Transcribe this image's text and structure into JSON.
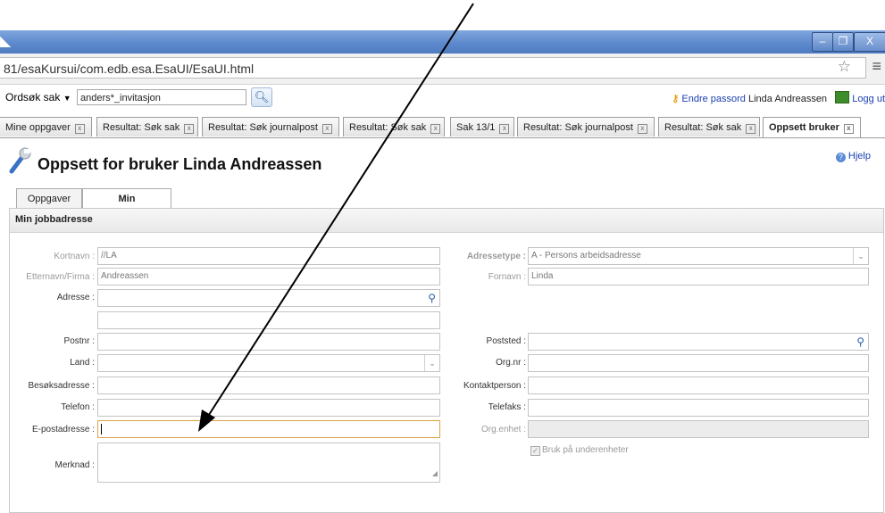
{
  "browser": {
    "url": "81/esaKursui/com.edb.esa.EsaUI/EsaUI.html",
    "window_buttons": [
      "–",
      "❐",
      "X"
    ]
  },
  "toolbar": {
    "search_type": "Ordsøk sak",
    "search_value": "anders*_invitasjon",
    "change_password": "Endre passord",
    "user_name": "Linda Andreassen",
    "logout": "Logg ut"
  },
  "tabs": [
    {
      "label": "Mine oppgaver"
    },
    {
      "label": "Resultat: Søk sak"
    },
    {
      "label": "Resultat: Søk journalpost"
    },
    {
      "label": "Resultat: Søk sak"
    },
    {
      "label": "Sak 13/1"
    },
    {
      "label": "Resultat: Søk journalpost"
    },
    {
      "label": "Resultat: Søk sak"
    },
    {
      "label": "Oppsett bruker",
      "active": true
    }
  ],
  "page": {
    "title": "Oppsett for bruker Linda Andreassen",
    "help": "Hjelp",
    "subtabs": [
      "Oppgaver",
      "Min jobbadresse"
    ],
    "panel_title": "Min jobbadresse"
  },
  "form": {
    "kortnavn": {
      "label": "Kortnavn :",
      "value": "//LA"
    },
    "etternavn": {
      "label": "Etternavn/Firma :",
      "value": "Andreassen"
    },
    "adresse": {
      "label": "Adresse :",
      "value": ""
    },
    "adresse2": {
      "value": ""
    },
    "postnr": {
      "label": "Postnr :",
      "value": ""
    },
    "land": {
      "label": "Land :",
      "value": ""
    },
    "besoksadresse": {
      "label": "Besøksadresse :",
      "value": ""
    },
    "telefon": {
      "label": "Telefon :",
      "value": ""
    },
    "epost": {
      "label": "E-postadresse :",
      "value": ""
    },
    "merknad": {
      "label": "Merknad :",
      "value": ""
    },
    "adressetype": {
      "label": "Adressetype :",
      "value": "A - Persons arbeidsadresse"
    },
    "fornavn": {
      "label": "Fornavn :",
      "value": "Linda"
    },
    "poststed": {
      "label": "Poststed :",
      "value": ""
    },
    "orgnr": {
      "label": "Org.nr :",
      "value": ""
    },
    "kontaktperson": {
      "label": "Kontaktperson :",
      "value": ""
    },
    "telefaks": {
      "label": "Telefaks :",
      "value": ""
    },
    "orgenhet": {
      "label": "Org.enhet :",
      "value": ""
    },
    "bruk_underenheter": {
      "label": "Bruk på underenheter",
      "checked": true
    }
  },
  "colors": {
    "titlebar": "#5b87cc",
    "link": "#1a3fb0",
    "focus_border": "#d9a54a",
    "arrow": "#000000"
  }
}
